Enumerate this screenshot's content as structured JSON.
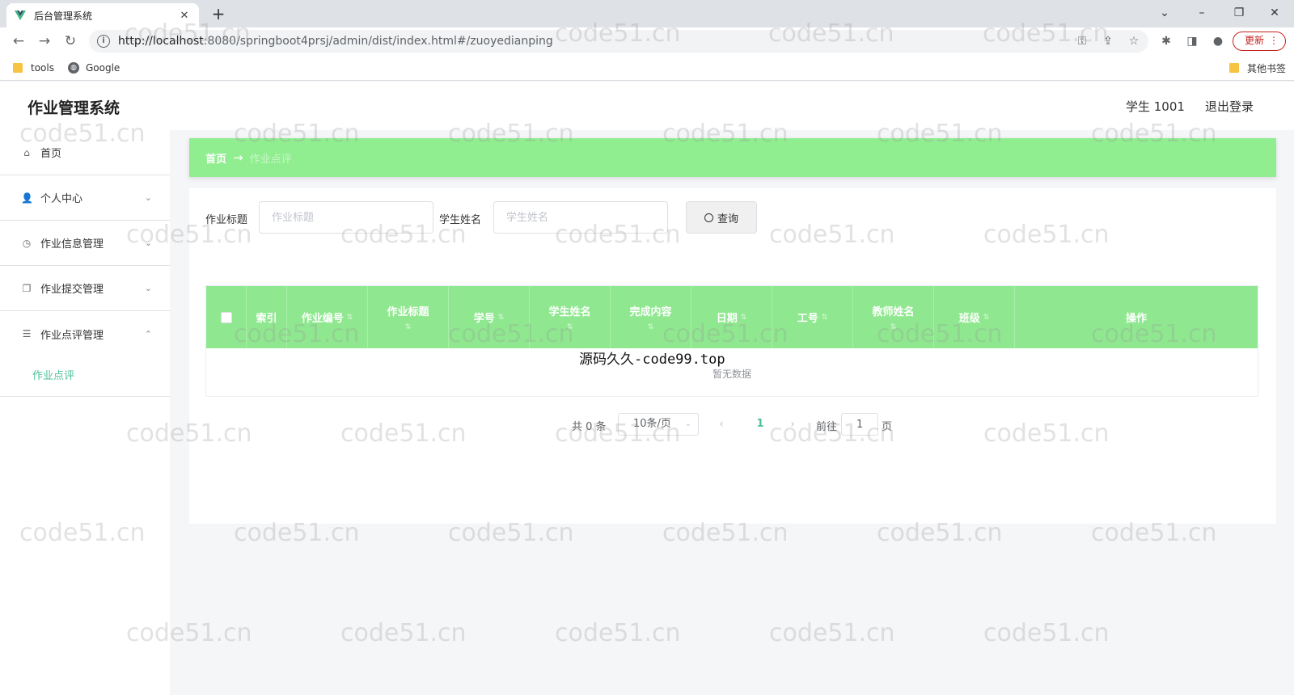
{
  "browser": {
    "tab_title": "后台管理系统",
    "tab_close": "✕",
    "new_tab": "+",
    "url_host": "http://localhost",
    "url_rest": ":8080/springboot4prsj/admin/dist/index.html#/zuoyedianping",
    "update_label": "更新",
    "bookmarks": [
      {
        "label": "tools"
      },
      {
        "label": "Google"
      }
    ],
    "other_bookmarks": "其他书签"
  },
  "header": {
    "app_title": "作业管理系统",
    "user": "学生 1001",
    "logout": "退出登录"
  },
  "sidebar": {
    "items": [
      {
        "label": "首页",
        "icon": "home-icon"
      },
      {
        "label": "个人中心",
        "icon": "user-icon"
      },
      {
        "label": "作业信息管理",
        "icon": "clock-icon"
      },
      {
        "label": "作业提交管理",
        "icon": "copy-icon"
      },
      {
        "label": "作业点评管理",
        "icon": "list-icon"
      }
    ],
    "submenu": [
      {
        "label": "作业点评"
      }
    ]
  },
  "breadcrumb": {
    "home": "首页",
    "arrow": "→",
    "current": "作业点评"
  },
  "search": {
    "title_label": "作业标题",
    "title_placeholder": "作业标题",
    "name_label": "学生姓名",
    "name_placeholder": "学生姓名",
    "button": "查询"
  },
  "table": {
    "columns": [
      "索引",
      "作业编号",
      "作业标题",
      "学号",
      "学生姓名",
      "完成内容",
      "日期",
      "工号",
      "教师姓名",
      "班级",
      "操作"
    ],
    "empty_text": "暂无数据",
    "overlay_text": "源码久久-code99.top"
  },
  "pagination": {
    "total": "共 0 条",
    "page_size": "10条/页",
    "current_page": "1",
    "goto_label": "前往",
    "goto_value": "1",
    "page_suffix": "页"
  },
  "watermark": "code51.cn",
  "colors": {
    "accent_green": "#90ee90",
    "header_green": "#8fe88f",
    "active_teal": "#4dbf9a"
  }
}
